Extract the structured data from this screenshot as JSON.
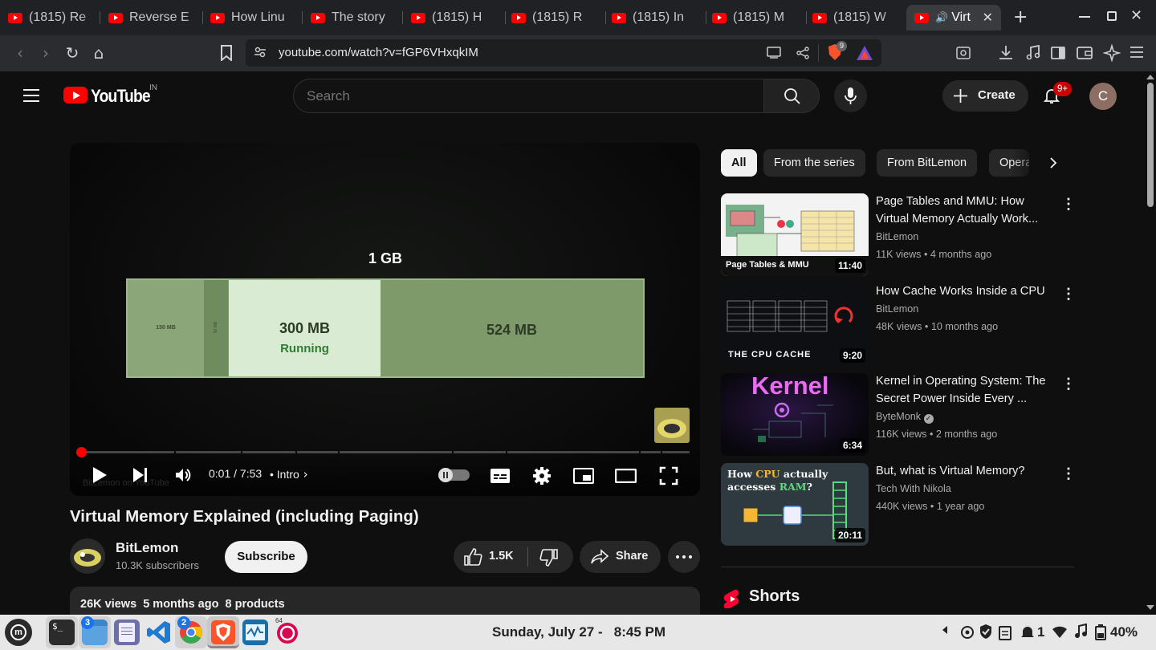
{
  "browser": {
    "tabs": [
      {
        "label": "(1815) Re"
      },
      {
        "label": "Reverse E"
      },
      {
        "label": "How Linu"
      },
      {
        "label": "The story"
      },
      {
        "label": "(1815) H"
      },
      {
        "label": "(1815) R"
      },
      {
        "label": "(1815) In"
      },
      {
        "label": "(1815) M"
      },
      {
        "label": "(1815) W"
      },
      {
        "label": "Virt"
      }
    ],
    "new_tab_symbol": "+",
    "url": "youtube.com/watch?v=fGP6VHxqkIM",
    "brave_shield_count": "9"
  },
  "youtube": {
    "logo_text": "YouTube",
    "country_code": "IN",
    "search_placeholder": "Search",
    "create_label": "Create",
    "notifications_badge": "9+",
    "avatar_initial": "C"
  },
  "player": {
    "slide_title": "1 GB",
    "block_small_label": "150 MB",
    "block_tiny_label": "50 MB",
    "block_running_size": "300 MB",
    "block_running_status": "Running",
    "block_free_label": "524 MB",
    "time_current": "0:01",
    "time_separator": "/",
    "time_total": "7:53",
    "chapter": "Intro",
    "watermark": "BitLemon on YouTube",
    "progress_fraction": 0.002
  },
  "video": {
    "title": "Virtual Memory Explained (including Paging)",
    "channel_name": "BitLemon",
    "subscribers": "10.3K subscribers",
    "subscribe_label": "Subscribe",
    "likes": "1.5K",
    "share_label": "Share",
    "views": "26K views",
    "age": "5 months ago",
    "products": "8 products"
  },
  "filters": [
    "All",
    "From the series",
    "From BitLemon",
    "Opera"
  ],
  "recommendations": [
    {
      "title": "Page Tables and MMU: How Virtual Memory Actually Work...",
      "channel": "BitLemon",
      "verified": false,
      "views": "11K views",
      "age": "4 months ago",
      "duration": "11:40",
      "thumb_caption": "Page Tables & MMU"
    },
    {
      "title": "How Cache Works Inside a CPU",
      "channel": "BitLemon",
      "verified": false,
      "views": "48K views",
      "age": "10 months ago",
      "duration": "9:20",
      "thumb_caption": "THE CPU CACHE"
    },
    {
      "title": "Kernel in Operating System: The Secret Power Inside Every ...",
      "channel": "ByteMonk",
      "verified": true,
      "views": "116K views",
      "age": "2 months ago",
      "duration": "6:34",
      "thumb_caption": "Kernel"
    },
    {
      "title": "But, what is Virtual Memory?",
      "channel": "Tech With Nikola",
      "verified": false,
      "views": "440K views",
      "age": "1 year ago",
      "duration": "20:11",
      "thumb_caption_a": "How ",
      "thumb_caption_b": "CPU",
      "thumb_caption_c": " actually",
      "thumb_caption_d": "accesses ",
      "thumb_caption_e": "RAM",
      "thumb_caption_f": "?"
    }
  ],
  "shorts_label": "Shorts",
  "taskbar": {
    "files_badge": "3",
    "chrome_badge": "2",
    "date": "Sunday, July 27 -",
    "time": "8:45 PM",
    "notif_count": "1",
    "battery": "40%",
    "sysmon_label": "64"
  },
  "colors": {
    "yt_red": "#ff0000",
    "slide_green_dark": "#7e9a6b",
    "slide_green_light": "#d9ecd3",
    "running_green": "#2e7d32"
  }
}
